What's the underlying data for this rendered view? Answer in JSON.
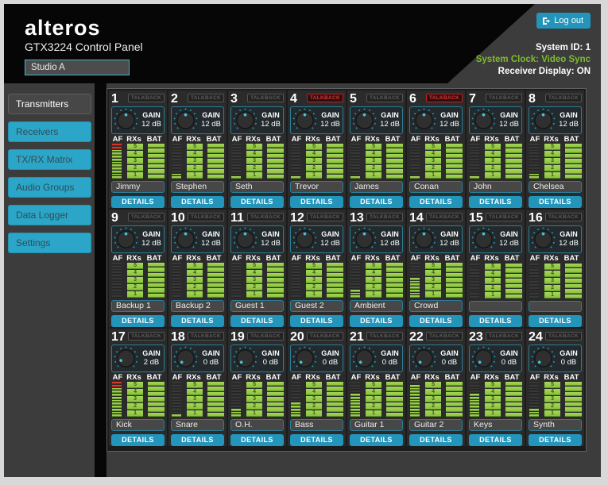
{
  "header": {
    "logo": "alteros",
    "title": "GTX3224 Control Panel",
    "studio_name": "Studio A",
    "logout_label": "Log out",
    "system_id_label": "System ID:",
    "system_id_value": "1",
    "system_clock_label": "System Clock:",
    "system_clock_value": "Video Sync",
    "receiver_display_label": "Receiver Display:",
    "receiver_display_value": "ON"
  },
  "sidebar": {
    "items": [
      {
        "label": "Transmitters",
        "active": true
      },
      {
        "label": "Receivers",
        "active": false
      },
      {
        "label": "TX/RX Matrix",
        "active": false
      },
      {
        "label": "Audio Groups",
        "active": false
      },
      {
        "label": "Data Logger",
        "active": false
      },
      {
        "label": "Settings",
        "active": false
      }
    ]
  },
  "panel": {
    "talkback_label": "TALKBACK",
    "gain_label": "GAIN",
    "meter_labels": [
      "AF",
      "RXs",
      "BAT"
    ],
    "details_label": "DETAILS",
    "af_segments": 12,
    "rxs_segments": 5,
    "bat_segments": 7,
    "channels": [
      {
        "num": 1,
        "name": "Jimmy",
        "gain": 12,
        "gain_db": "12 dB",
        "talkback": false,
        "af": 12,
        "af_red": 2,
        "rxs": 5,
        "bat": 7
      },
      {
        "num": 2,
        "name": "Stephen",
        "gain": 12,
        "gain_db": "12 dB",
        "talkback": false,
        "af": 2,
        "af_red": 0,
        "rxs": 5,
        "bat": 7
      },
      {
        "num": 3,
        "name": "Seth",
        "gain": 12,
        "gain_db": "12 dB",
        "talkback": false,
        "af": 1,
        "af_red": 0,
        "rxs": 5,
        "bat": 7
      },
      {
        "num": 4,
        "name": "Trevor",
        "gain": 12,
        "gain_db": "12 dB",
        "talkback": true,
        "af": 1,
        "af_red": 0,
        "rxs": 5,
        "bat": 7
      },
      {
        "num": 5,
        "name": "James",
        "gain": 12,
        "gain_db": "12 dB",
        "talkback": false,
        "af": 1,
        "af_red": 0,
        "rxs": 5,
        "bat": 7
      },
      {
        "num": 6,
        "name": "Conan",
        "gain": 12,
        "gain_db": "12 dB",
        "talkback": true,
        "af": 1,
        "af_red": 0,
        "rxs": 5,
        "bat": 7
      },
      {
        "num": 7,
        "name": "John",
        "gain": 12,
        "gain_db": "12 dB",
        "talkback": false,
        "af": 1,
        "af_red": 0,
        "rxs": 5,
        "bat": 7
      },
      {
        "num": 8,
        "name": "Chelsea",
        "gain": 12,
        "gain_db": "12 dB",
        "talkback": false,
        "af": 2,
        "af_red": 0,
        "rxs": 5,
        "bat": 7
      },
      {
        "num": 9,
        "name": "Backup 1",
        "gain": 12,
        "gain_db": "12 dB",
        "talkback": false,
        "af": 0,
        "af_red": 0,
        "rxs": 5,
        "bat": 7
      },
      {
        "num": 10,
        "name": "Backup 2",
        "gain": 12,
        "gain_db": "12 dB",
        "talkback": false,
        "af": 0,
        "af_red": 0,
        "rxs": 5,
        "bat": 7
      },
      {
        "num": 11,
        "name": "Guest 1",
        "gain": 12,
        "gain_db": "12 dB",
        "talkback": false,
        "af": 0,
        "af_red": 0,
        "rxs": 5,
        "bat": 7
      },
      {
        "num": 12,
        "name": "Guest 2",
        "gain": 12,
        "gain_db": "12 dB",
        "talkback": false,
        "af": 0,
        "af_red": 0,
        "rxs": 5,
        "bat": 7
      },
      {
        "num": 13,
        "name": "Ambient",
        "gain": 12,
        "gain_db": "12 dB",
        "talkback": false,
        "af": 3,
        "af_red": 0,
        "rxs": 5,
        "bat": 7
      },
      {
        "num": 14,
        "name": "Crowd",
        "gain": 12,
        "gain_db": "12 dB",
        "talkback": false,
        "af": 7,
        "af_red": 0,
        "rxs": 5,
        "bat": 7
      },
      {
        "num": 15,
        "name": "",
        "gain": 12,
        "gain_db": "12 dB",
        "talkback": false,
        "af": 0,
        "af_red": 0,
        "rxs": 5,
        "bat": 7
      },
      {
        "num": 16,
        "name": "",
        "gain": 12,
        "gain_db": "12 dB",
        "talkback": false,
        "af": 0,
        "af_red": 0,
        "rxs": 5,
        "bat": 7
      },
      {
        "num": 17,
        "name": "Kick",
        "gain": 2,
        "gain_db": "2 dB",
        "talkback": false,
        "af": 12,
        "af_red": 2,
        "rxs": 5,
        "bat": 7
      },
      {
        "num": 18,
        "name": "Snare",
        "gain": 0,
        "gain_db": "0 dB",
        "talkback": false,
        "af": 1,
        "af_red": 0,
        "rxs": 5,
        "bat": 7
      },
      {
        "num": 19,
        "name": "O.H.",
        "gain": 0,
        "gain_db": "0 dB",
        "talkback": false,
        "af": 3,
        "af_red": 0,
        "rxs": 5,
        "bat": 7
      },
      {
        "num": 20,
        "name": "Bass",
        "gain": 0,
        "gain_db": "0 dB",
        "talkback": false,
        "af": 5,
        "af_red": 0,
        "rxs": 5,
        "bat": 7
      },
      {
        "num": 21,
        "name": "Guitar 1",
        "gain": 0,
        "gain_db": "0 dB",
        "talkback": false,
        "af": 8,
        "af_red": 0,
        "rxs": 5,
        "bat": 7
      },
      {
        "num": 22,
        "name": "Guitar 2",
        "gain": 0,
        "gain_db": "0 dB",
        "talkback": false,
        "af": 11,
        "af_red": 0,
        "rxs": 5,
        "bat": 7
      },
      {
        "num": 23,
        "name": "Keys",
        "gain": 0,
        "gain_db": "0 dB",
        "talkback": false,
        "af": 8,
        "af_red": 0,
        "rxs": 5,
        "bat": 7
      },
      {
        "num": 24,
        "name": "Synth",
        "gain": 0,
        "gain_db": "0 dB",
        "talkback": false,
        "af": 3,
        "af_red": 0,
        "rxs": 5,
        "bat": 7
      }
    ]
  },
  "colors": {
    "accent_cyan": "#2ba6c9",
    "button_cyan": "#2395bb",
    "meter_green": "#8fc83e",
    "alert_red": "#d42020",
    "clock_green": "#7fbb2e"
  }
}
